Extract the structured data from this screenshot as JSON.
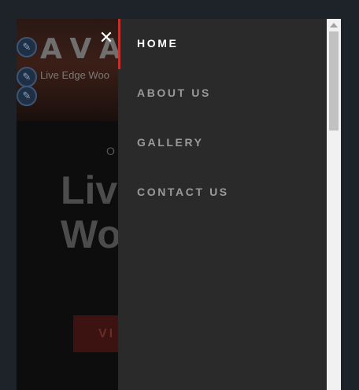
{
  "site": {
    "logo_text": "AVA",
    "tagline": "Live Edge Woo",
    "kicker": "O",
    "hero_title_line1": "Liv",
    "hero_title_line2": "Wo",
    "hero_button_label": "VI"
  },
  "menu": {
    "items": [
      {
        "label": "HOME",
        "active": true
      },
      {
        "label": "ABOUT US",
        "active": false
      },
      {
        "label": "GALLERY",
        "active": false
      },
      {
        "label": "CONTACT US",
        "active": false
      }
    ],
    "close_icon": "close-icon",
    "edit_icon": "pencil-icon"
  },
  "colors": {
    "accent": "#c5302a",
    "menu_bg": "#2a2a2a",
    "active_item": "#ffffff",
    "inactive_item": "#9a9a9a"
  }
}
